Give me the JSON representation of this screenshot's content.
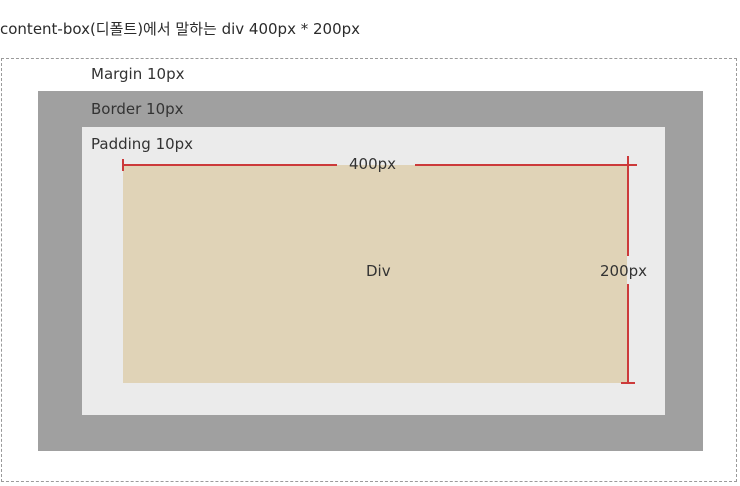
{
  "title": "content-box(디폴트)에서 말하는 div 400px * 200px",
  "layers": {
    "margin_label": "Margin 10px",
    "border_label": "Border 10px",
    "padding_label": "Padding 10px",
    "content_label": "Div"
  },
  "dimensions": {
    "width_label": "400px",
    "height_label": "200px"
  },
  "colors": {
    "border_fill": "#a0a0a0",
    "padding_fill": "#ebebeb",
    "content_fill": "#e0d3b7",
    "dimension_line": "#cc3a3a"
  }
}
